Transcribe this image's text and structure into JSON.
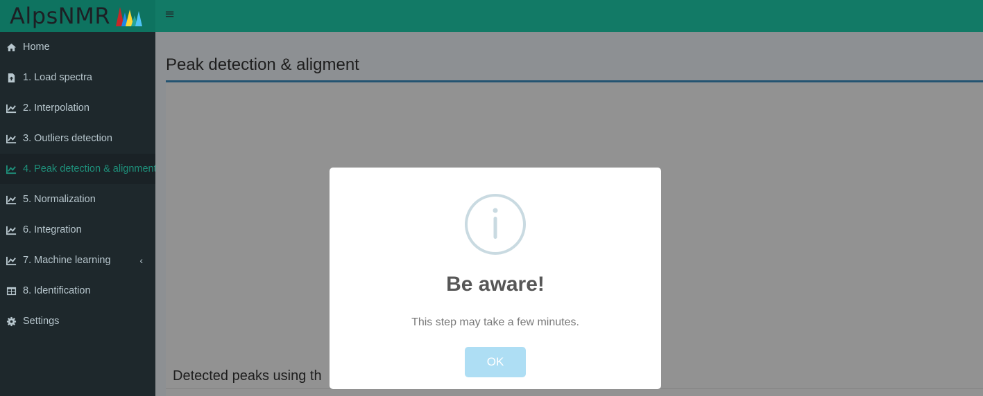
{
  "app": {
    "title": "AlpsNMR",
    "menu_icon": "≡"
  },
  "colors": {
    "header_logo_bg": "#0e7360",
    "header_bg": "#127a66",
    "sidebar_bg": "#1e282c",
    "active_text": "#1e8f7a",
    "accent_rule": "#3c8dbc",
    "ok_button": "#aedef4"
  },
  "sidebar": {
    "items": [
      {
        "label": "Home",
        "icon": "home-icon"
      },
      {
        "label": "1. Load spectra",
        "icon": "file-upload-icon"
      },
      {
        "label": "2. Interpolation",
        "icon": "line-chart-icon"
      },
      {
        "label": "3. Outliers detection",
        "icon": "line-chart-icon"
      },
      {
        "label": "4. Peak detection & alignment",
        "icon": "line-chart-icon",
        "active": true
      },
      {
        "label": "5. Normalization",
        "icon": "line-chart-icon"
      },
      {
        "label": "6. Integration",
        "icon": "line-chart-icon"
      },
      {
        "label": "7. Machine learning",
        "icon": "line-chart-icon",
        "chevron": "‹"
      },
      {
        "label": "8. Identification",
        "icon": "table-icon"
      },
      {
        "label": "Settings",
        "icon": "gear-icon"
      }
    ]
  },
  "main": {
    "page_title": "Peak detection & aligment",
    "section_title": "Detected peaks using th"
  },
  "modal": {
    "icon": "info-icon",
    "title": "Be aware!",
    "text": "This step may take a few minutes.",
    "ok_label": "OK"
  }
}
